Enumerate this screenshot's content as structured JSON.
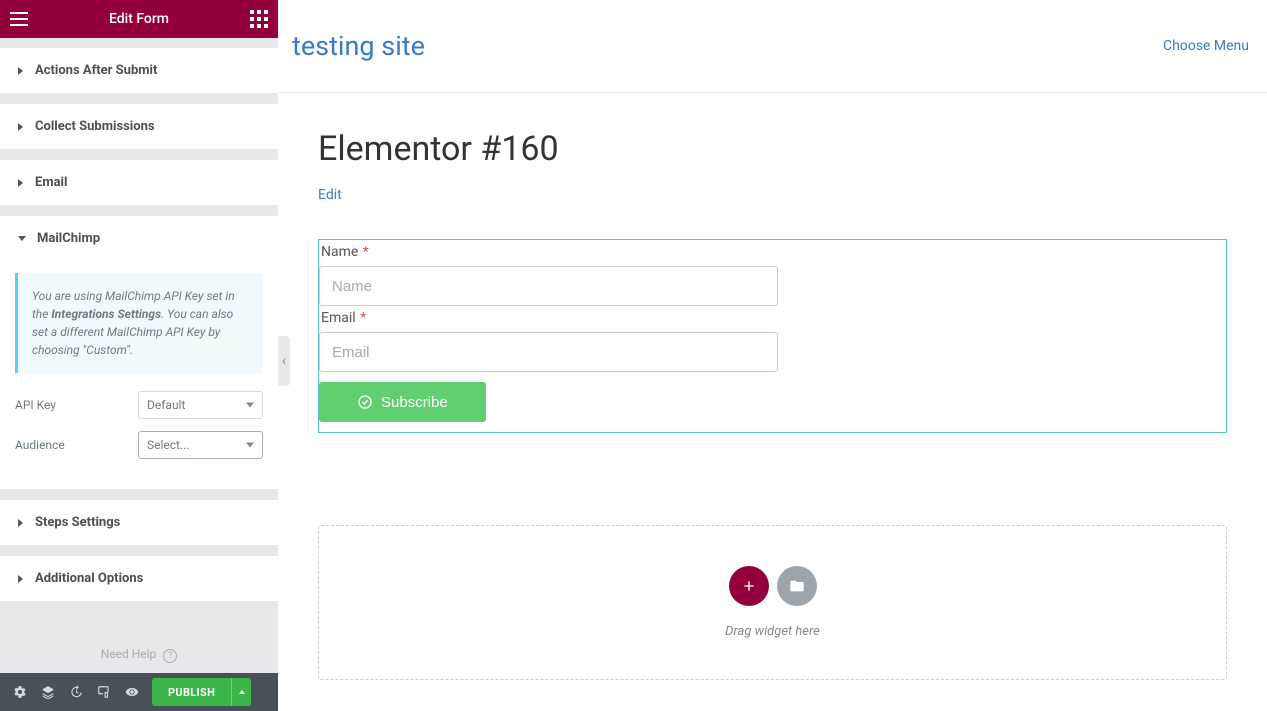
{
  "sidebar": {
    "header_title": "Edit Form",
    "help_label": "Need Help",
    "publish_label": "PUBLISH",
    "sections": {
      "actions_after_submit": "Actions After Submit",
      "collect_submissions": "Collect Submissions",
      "email": "Email",
      "mailchimp": {
        "title": "MailChimp",
        "notice_pre": "You are using MailChimp API Key set in the ",
        "notice_bold": "Integrations Settings",
        "notice_post": ". You can also set a different MailChimp API Key by choosing \"Custom\".",
        "api_key_label": "API Key",
        "api_key_value": "Default",
        "audience_label": "Audience",
        "audience_value": "Select..."
      },
      "steps_settings": "Steps Settings",
      "additional_options": "Additional Options"
    }
  },
  "preview": {
    "site_title": "testing site",
    "choose_menu": "Choose Menu",
    "page_title": "Elementor #160",
    "edit_link": "Edit",
    "form": {
      "name_label": "Name",
      "email_label": "Email",
      "name_placeholder": "Name",
      "email_placeholder": "Email",
      "subscribe_label": "Subscribe"
    },
    "dropzone_text": "Drag widget here"
  }
}
